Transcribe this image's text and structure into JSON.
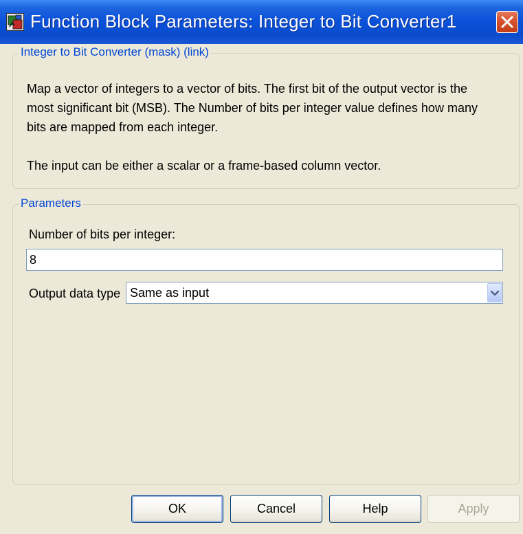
{
  "window": {
    "title": "Function Block Parameters: Integer to Bit Converter1",
    "icon": "simulink-block-icon",
    "close_icon": "close-icon"
  },
  "description_group": {
    "legend": "Integer to Bit Converter (mask) (link)",
    "lines": [
      "Map a vector of integers to a vector of bits. The first bit of the output vector is the",
      "most significant bit (MSB). The Number of bits per integer value defines how many",
      "bits are mapped from each integer.",
      "",
      "The input can be either a scalar or a frame-based column vector."
    ]
  },
  "parameters_group": {
    "legend": "Parameters",
    "bits_label": "Number of bits per integer:",
    "bits_value": "8",
    "output_type_label": "Output data type",
    "output_type_value": "Same as input"
  },
  "buttons": {
    "ok": "OK",
    "cancel": "Cancel",
    "help": "Help",
    "apply": "Apply"
  },
  "colors": {
    "titlebar": "#0a50d8",
    "legend_text": "#0046d5",
    "dialog_bg": "#ece9d8"
  }
}
